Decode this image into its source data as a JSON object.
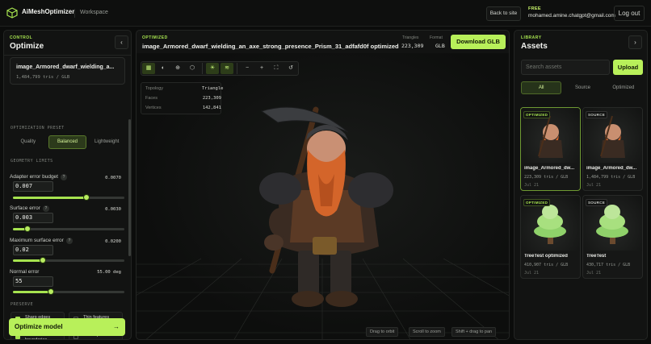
{
  "topbar": {
    "app_title": "AiMeshOptimizer",
    "workspace": "Workspace",
    "back_label": "Back to site",
    "plan": "FREE",
    "email": "mohamed.amine.chatgpt@gmail.com",
    "logout_label": "Log out"
  },
  "control": {
    "eyebrow": "CONTROL",
    "title": "Optimize",
    "collapse_icon": "chevron-left-icon",
    "model": {
      "name": "image_Armored_dwarf_wielding_a...",
      "meta": "1,484,799 tris / GLB"
    },
    "preset_label": "OPTIMIZATION PRESET",
    "presets": [
      "Quality",
      "Balanced",
      "Lightweight"
    ],
    "selected_preset": "Balanced",
    "limits_label": "GEOMETRY LIMITS",
    "fields": [
      {
        "label": "Adapter error budget",
        "value_text": "0.0070",
        "input": "0.007",
        "level": 0.66
      },
      {
        "label": "Surface error",
        "value_text": "0.0030",
        "input": "0.003",
        "level": 0.13
      },
      {
        "label": "Maximum surface error",
        "value_text": "0.0200",
        "input": "0.02",
        "level": 0.27
      },
      {
        "label": "Normal error",
        "value_text": "55.00 deg",
        "input": "55",
        "level": 0.34
      }
    ],
    "preserve_label": "PRESERVE",
    "checks": [
      {
        "label": "Sharp edges",
        "checked": true
      },
      {
        "label": "Thin features",
        "checked": false
      },
      {
        "label": "Material boundaries",
        "checked": true
      },
      {
        "label": "Weld split vertices",
        "checked": false
      }
    ],
    "optimize_label": "Optimize model",
    "optimize_arrow": "→"
  },
  "viewer": {
    "eyebrow": "OPTIMIZED",
    "title": "image_Armored_dwarf_wielding_an_axe_strong_presence_Prism_31_adfafd0f optimized",
    "triangles_label": "Triangles",
    "triangles_value": "223,309",
    "format_label": "Format",
    "format_value": "GLB",
    "download_label": "Download GLB",
    "tools": [
      "grid-icon",
      "half-circle-icon",
      "globe-icon",
      "cube-icon",
      "sun-icon",
      "layers-icon",
      "minus-icon",
      "plus-icon",
      "fit-icon",
      "reset-icon"
    ],
    "info": [
      {
        "label": "Topology",
        "value": "Triangle"
      },
      {
        "label": "Faces",
        "value": "223,309"
      },
      {
        "label": "Vertices",
        "value": "142,841"
      }
    ],
    "hints": [
      "Drag to orbit",
      "Scroll to zoom",
      "Shift + drag to pan"
    ]
  },
  "library": {
    "eyebrow": "LIBRARY",
    "title": "Assets",
    "expand_icon": "chevron-right-icon",
    "search_placeholder": "Search assets",
    "upload_label": "Upload",
    "filters": [
      "All",
      "Source",
      "Optimized"
    ],
    "selected_filter": "All",
    "assets": [
      {
        "tag": "OPTIMIZED",
        "name": "image_Armored_dw...",
        "meta": "223,309 tris / GLB",
        "date": "Jul 21"
      },
      {
        "tag": "SOURCE",
        "name": "image_Armored_dw...",
        "meta": "1,484,799 tris / GLB",
        "date": "Jul 21"
      },
      {
        "tag": "OPTIMIZED",
        "name": "TreeTest optimized",
        "meta": "410,907 tris / GLB",
        "date": "Jul 21"
      },
      {
        "tag": "SOURCE",
        "name": "TreeTest",
        "meta": "430,717 tris / GLB",
        "date": "Jul 21"
      }
    ]
  },
  "colors": {
    "accent": "#b8f05a",
    "background": "#0b0c0b",
    "panel": "#121312"
  }
}
